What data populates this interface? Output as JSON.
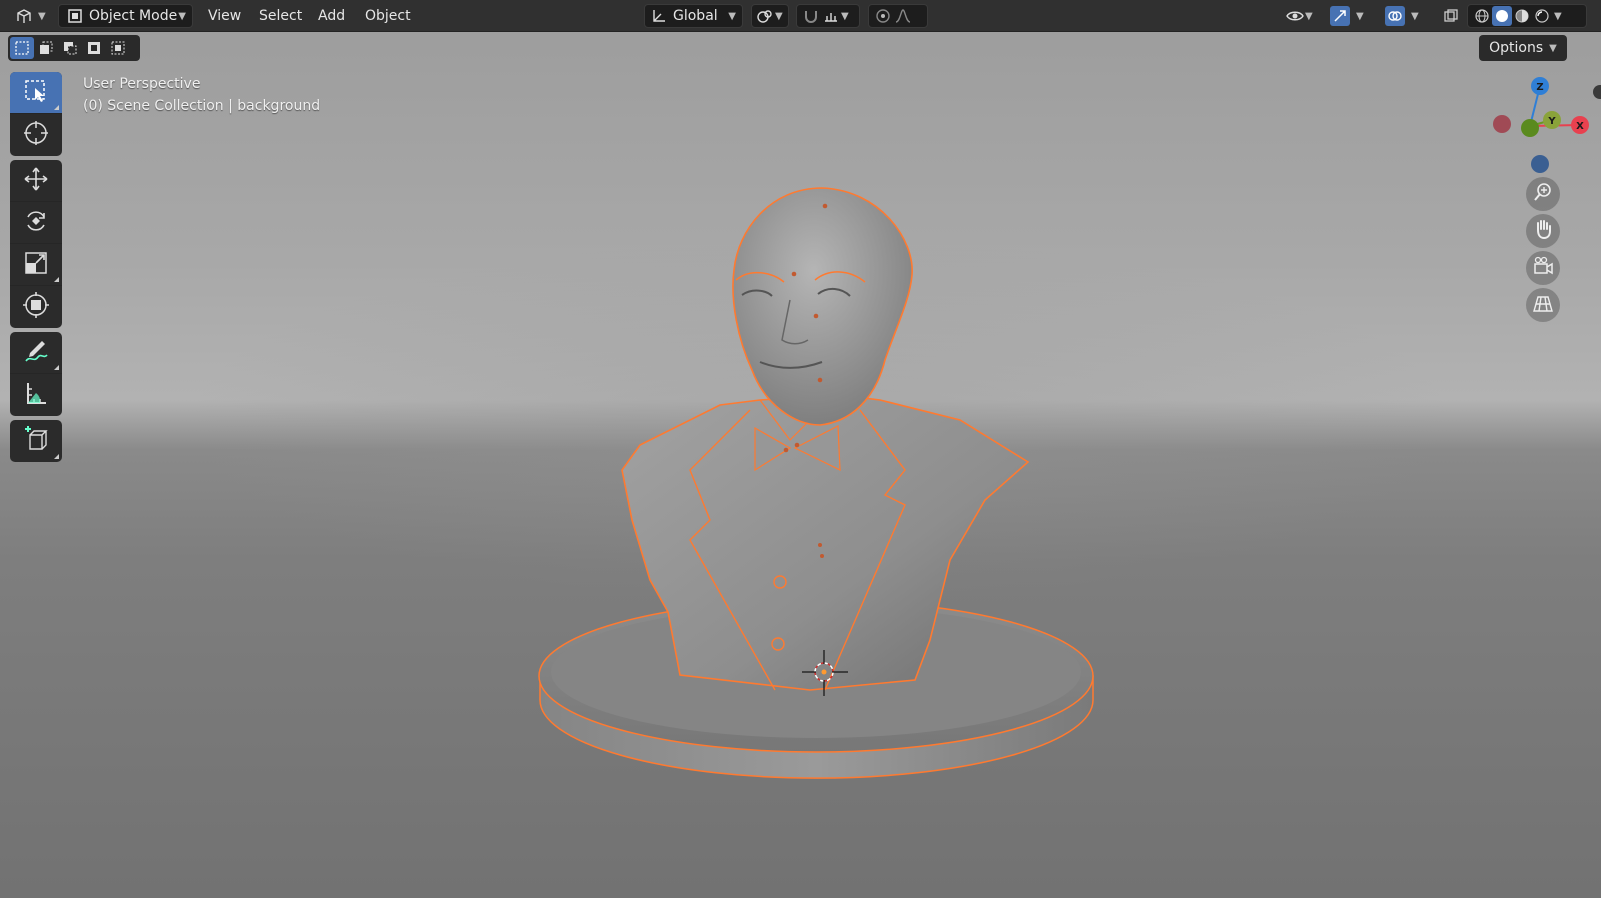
{
  "header": {
    "editor_type_icon": "3d-viewport-icon",
    "mode_label": "Object Mode",
    "menus": [
      "View",
      "Select",
      "Add",
      "Object"
    ],
    "transform_orientation": "Global",
    "options_label": "Options"
  },
  "viewport": {
    "view_name": "User Perspective",
    "collection_info": "(0) Scene Collection | background"
  },
  "gizmo": {
    "axes": {
      "x": "X",
      "y": "Y",
      "z": "Z"
    },
    "colors": {
      "x": "#e8414f",
      "y": "#6a9a24",
      "z": "#2f7fd6",
      "neg_x": "#a04a55",
      "neg_z": "#3a5f92"
    }
  },
  "toolbar": {
    "tools": [
      "select-box-icon",
      "cursor-icon",
      "move-icon",
      "rotate-icon",
      "scale-icon",
      "transform-icon",
      "annotate-icon",
      "measure-icon",
      "add-cube-icon"
    ]
  },
  "colors": {
    "accent": "#4772b3",
    "selection_outline": "#ff7a30",
    "header_bg": "#303030"
  }
}
